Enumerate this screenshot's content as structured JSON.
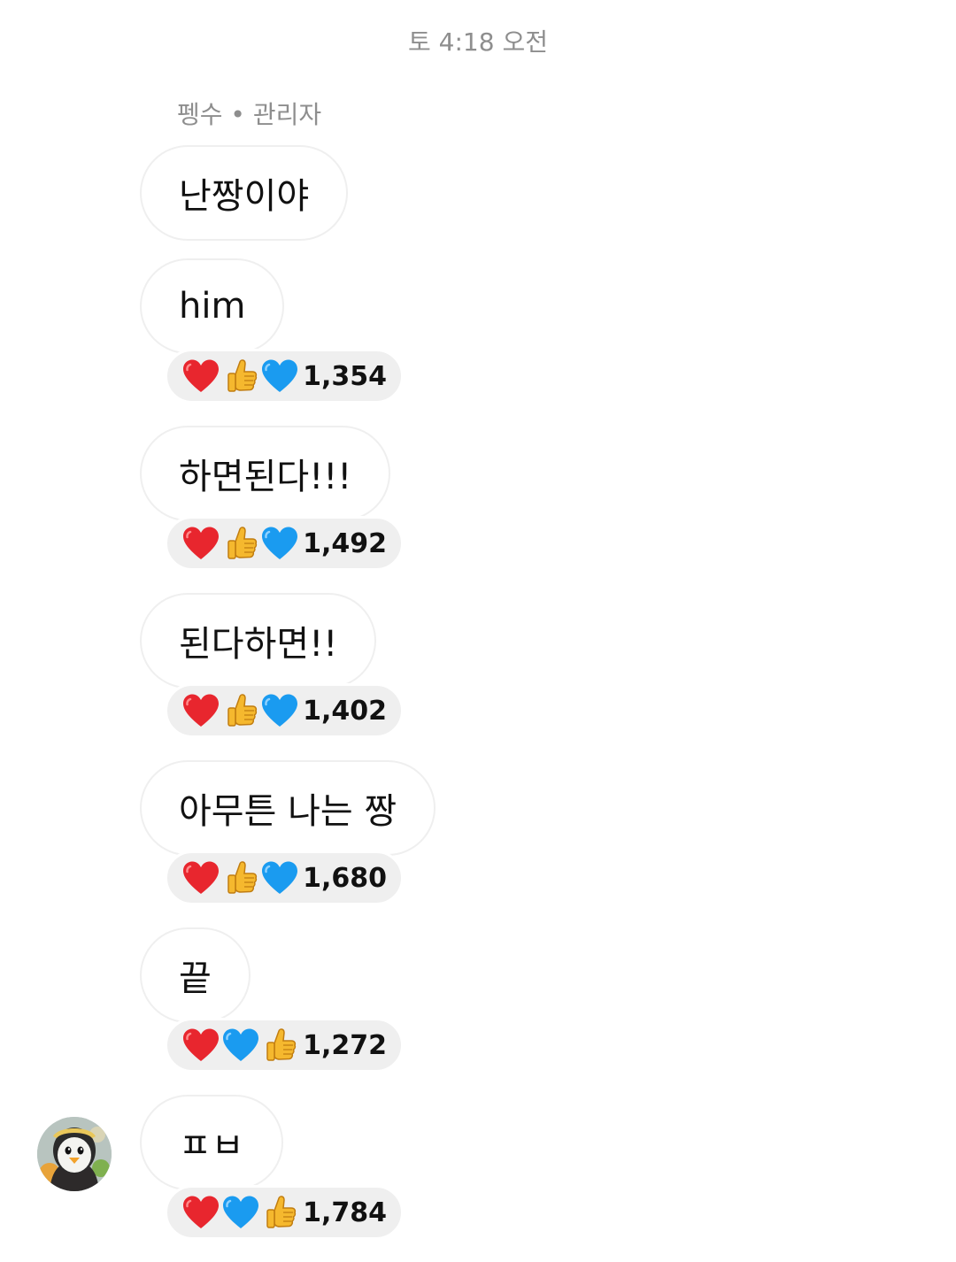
{
  "header": {
    "timestamp": "토 4:18 오전"
  },
  "sender": {
    "label": "펭수 • 관리자"
  },
  "messages": [
    {
      "text": "난짱이야",
      "reactions": null
    },
    {
      "text": "him",
      "reactions": {
        "emojis": [
          "red-heart",
          "thumbs-up",
          "blue-heart"
        ],
        "count": "1,354"
      }
    },
    {
      "text": "하면된다!!!",
      "reactions": {
        "emojis": [
          "red-heart",
          "thumbs-up",
          "blue-heart"
        ],
        "count": "1,492"
      }
    },
    {
      "text": "된다하면!!",
      "reactions": {
        "emojis": [
          "red-heart",
          "thumbs-up",
          "blue-heart"
        ],
        "count": "1,402"
      }
    },
    {
      "text": "아무튼 나는 짱",
      "reactions": {
        "emojis": [
          "red-heart",
          "thumbs-up",
          "blue-heart"
        ],
        "count": "1,680"
      }
    },
    {
      "text": "끝",
      "reactions": {
        "emojis": [
          "red-heart",
          "blue-heart",
          "thumbs-up"
        ],
        "count": "1,272"
      }
    },
    {
      "text": "ㅍㅂ",
      "reactions": {
        "emojis": [
          "red-heart",
          "blue-heart",
          "thumbs-up"
        ],
        "count": "1,784"
      }
    }
  ],
  "avatar": {
    "icon": "penguin-avatar-icon"
  },
  "colors": {
    "red_heart": "#e8262e",
    "blue_heart": "#1a9bf0",
    "thumb": "#f5b82e",
    "bubble_border": "#efefef",
    "reaction_bg": "#efefef",
    "meta_text": "#8e8e8e"
  }
}
